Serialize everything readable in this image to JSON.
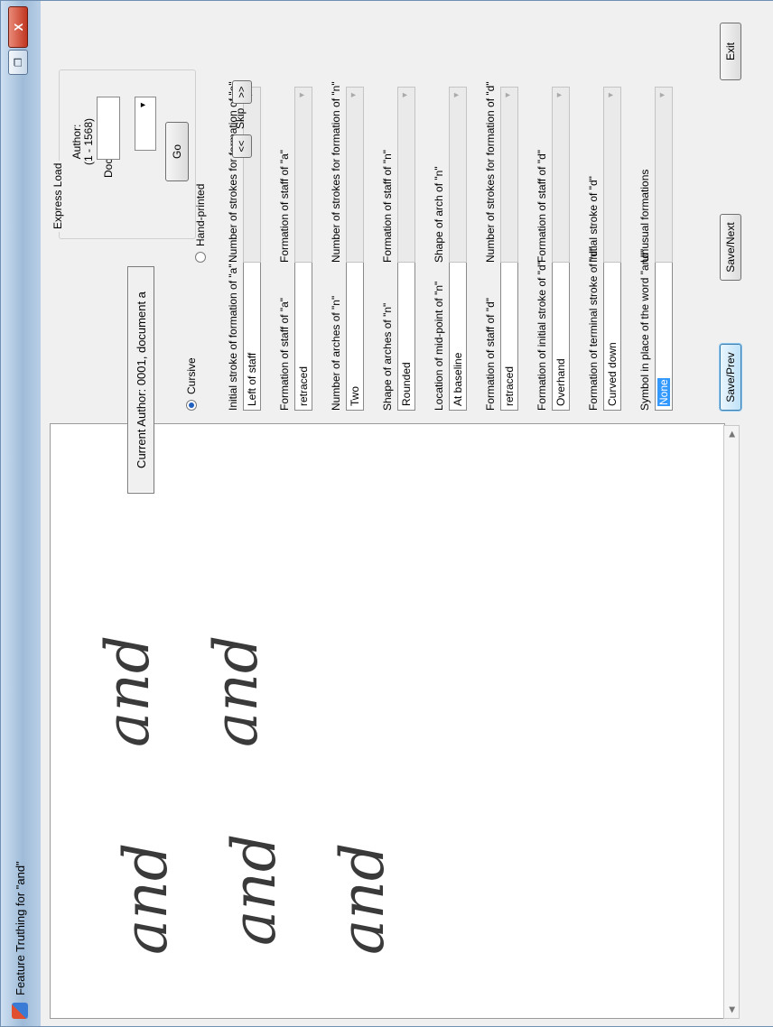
{
  "window": {
    "title": "Feature Truthing for \"and\"",
    "maximize_glyph": "❐",
    "close_glyph": "X"
  },
  "handwriting_samples": [
    "and",
    "and",
    "and",
    "and",
    "and"
  ],
  "status": {
    "current_author": "Current Author: 0001, document a"
  },
  "style": {
    "cursive_label": "Cursive",
    "handprinted_label": "Hand-printed",
    "cursive_selected": true
  },
  "cursive_fields": [
    {
      "label": "Initial stroke of formation of \"a\"",
      "value": "Left of staff"
    },
    {
      "label": "Formation of staff of \"a\"",
      "value": "retraced"
    },
    {
      "label": "Number of arches of \"n\"",
      "value": "Two"
    },
    {
      "label": "Shape of arches of \"n\"",
      "value": "Rounded"
    },
    {
      "label": "Location of mid-point of \"n\"",
      "value": "At baseline"
    },
    {
      "label": "Formation of staff of \"d\"",
      "value": "retraced"
    },
    {
      "label": "Formation of initial stroke of \"d\"",
      "value": "Overhand"
    },
    {
      "label": "Formation of terminal stroke of \"d\"",
      "value": "Curved down"
    },
    {
      "label": "Symbol in place of the word \"and\"",
      "value": "None"
    }
  ],
  "handprinted_fields": [
    {
      "label": "Number of strokes for formation of \"a\"",
      "value": ""
    },
    {
      "label": "Formation of staff of \"a\"",
      "value": ""
    },
    {
      "label": "Number of strokes for formation of \"n\"",
      "value": ""
    },
    {
      "label": "Formation of staff of \"n\"",
      "value": ""
    },
    {
      "label": "Shape of arch of \"n\"",
      "value": ""
    },
    {
      "label": "Number of strokes for formation of \"d\"",
      "value": ""
    },
    {
      "label": "Formation of staff of \"d\"",
      "value": ""
    },
    {
      "label": "Initial stroke of \"d\"",
      "value": ""
    },
    {
      "label": "Unusual formations",
      "value": ""
    }
  ],
  "express_load": {
    "title": "Express Load",
    "author_label": "Author:",
    "author_range": "(1 - 1568)",
    "doc_label": "Doc:",
    "author_value": "",
    "doc_value": "",
    "go_label": "Go"
  },
  "nav": {
    "prev_label": "<<",
    "skip_label": "Skip",
    "next_label": ">>"
  },
  "buttons": {
    "save_prev": "Save/Prev",
    "save_next": "Save/Next",
    "exit": "Exit"
  }
}
